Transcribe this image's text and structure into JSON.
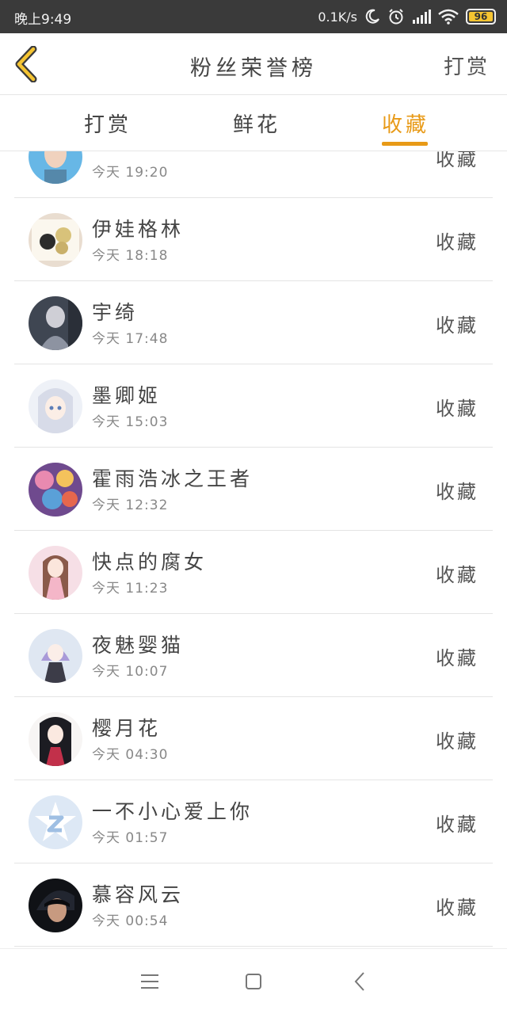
{
  "status_bar": {
    "time": "晚上9:49",
    "network_speed": "0.1K/s",
    "battery_level": "96",
    "icons": [
      "moon-icon",
      "alarm-icon",
      "signal-icon",
      "wifi-icon",
      "battery-icon"
    ]
  },
  "header": {
    "title": "粉丝荣誉榜",
    "action_label": "打赏",
    "back_icon": "chevron-left-icon",
    "accent_color": "#e89a17"
  },
  "tabs": [
    {
      "label": "打赏",
      "active": false
    },
    {
      "label": "鲜花",
      "active": false
    },
    {
      "label": "收藏",
      "active": true
    }
  ],
  "fans": [
    {
      "name": "",
      "time": "今天 19:20",
      "action": "收藏"
    },
    {
      "name": "伊娃格林",
      "time": "今天 18:18",
      "action": "收藏"
    },
    {
      "name": "宇绮",
      "time": "今天 17:48",
      "action": "收藏"
    },
    {
      "name": "墨卿姬",
      "time": "今天 15:03",
      "action": "收藏"
    },
    {
      "name": "霍雨浩冰之王者",
      "time": "今天 12:32",
      "action": "收藏"
    },
    {
      "name": "快点的腐女",
      "time": "今天 11:23",
      "action": "收藏"
    },
    {
      "name": "夜魅婴猫",
      "time": "今天 10:07",
      "action": "收藏"
    },
    {
      "name": "樱月花",
      "time": "今天 04:30",
      "action": "收藏"
    },
    {
      "name": "一不小心爱上你",
      "time": "今天 01:57",
      "action": "收藏"
    },
    {
      "name": "慕容风云",
      "time": "今天 00:54",
      "action": "收藏"
    }
  ],
  "nav_bar": {
    "icons": [
      "menu-icon",
      "home-icon",
      "back-icon"
    ]
  }
}
